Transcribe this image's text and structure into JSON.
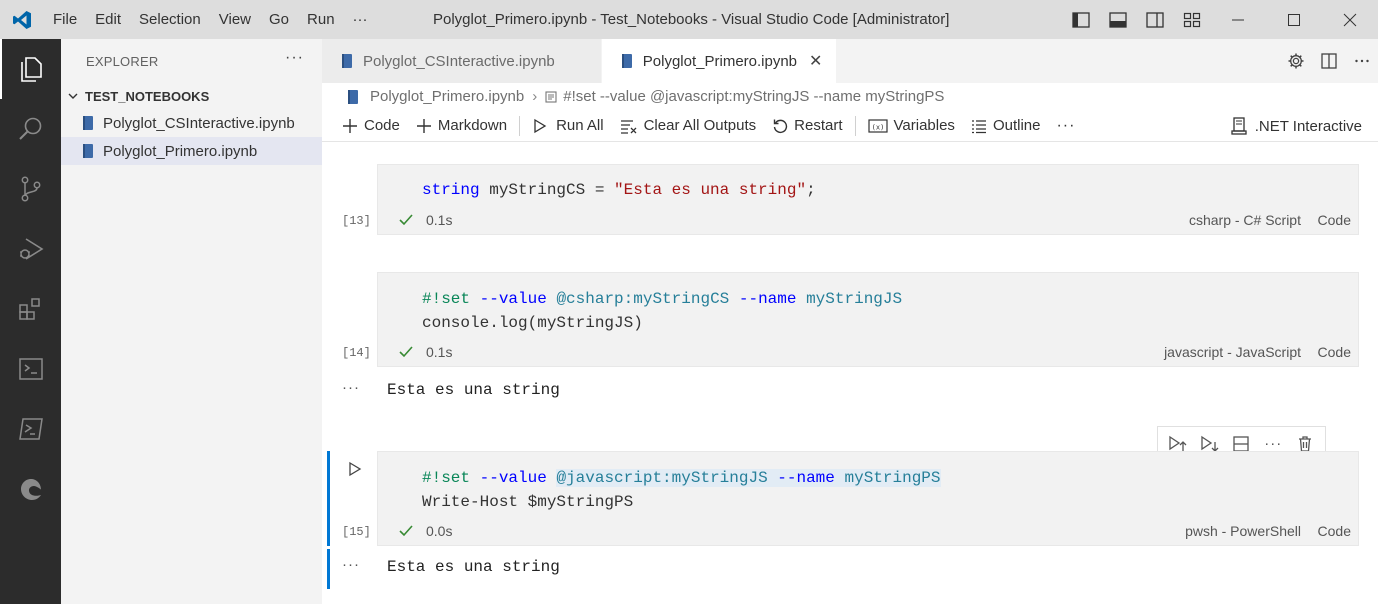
{
  "window": {
    "title": "Polyglot_Primero.ipynb - Test_Notebooks - Visual Studio Code [Administrator]",
    "menu": [
      "File",
      "Edit",
      "Selection",
      "View",
      "Go",
      "Run",
      "···"
    ]
  },
  "sidebar": {
    "header": "EXPLORER",
    "more": "···",
    "folder": "TEST_NOTEBOOKS",
    "files": [
      "Polyglot_CSInteractive.ipynb",
      "Polyglot_Primero.ipynb"
    ]
  },
  "tabs": [
    {
      "label": "Polyglot_CSInteractive.ipynb",
      "active": false
    },
    {
      "label": "Polyglot_Primero.ipynb",
      "active": true,
      "close": "✕"
    }
  ],
  "breadcrumb": {
    "file": "Polyglot_Primero.ipynb",
    "sep": "›",
    "symbol": "#!set --value @javascript:myStringJS --name myStringPS"
  },
  "toolbar": {
    "code": "Code",
    "markdown": "Markdown",
    "run_all": "Run All",
    "clear_all": "Clear All Outputs",
    "restart": "Restart",
    "variables": "Variables",
    "outline": "Outline",
    "more": "···",
    "kernel": ".NET Interactive"
  },
  "cells": [
    {
      "exec": "[13]",
      "lines": [
        [
          "string",
          " myStringCS = ",
          "\"Esta es una string\"",
          ";"
        ]
      ],
      "time": "0.1s",
      "language": "csharp - C# Script",
      "type": "Code"
    },
    {
      "exec": "[14]",
      "line1": {
        "a": "#!set",
        "b": " --value ",
        "c": "@csharp:myStringCS",
        "d": " --name ",
        "e": "myStringJS"
      },
      "line2": "console.log(myStringJS)",
      "time": "0.1s",
      "language": "javascript - JavaScript",
      "type": "Code",
      "output": "Esta es una string"
    },
    {
      "exec": "[15]",
      "line1": {
        "a": "#!set",
        "b": " --value ",
        "c": "@javascript:myStringJS",
        "d": " --name ",
        "e": "myStringPS"
      },
      "line2": "Write-Host $myStringPS",
      "time": "0.0s",
      "language": "pwsh - PowerShell",
      "type": "Code",
      "output": "Esta es una string"
    }
  ],
  "out_more": "···",
  "cell_toolbar_more": "···",
  "colors": {
    "accent": "#0078d4",
    "activitybar": "#2c2c2c",
    "check": "#388a34"
  }
}
